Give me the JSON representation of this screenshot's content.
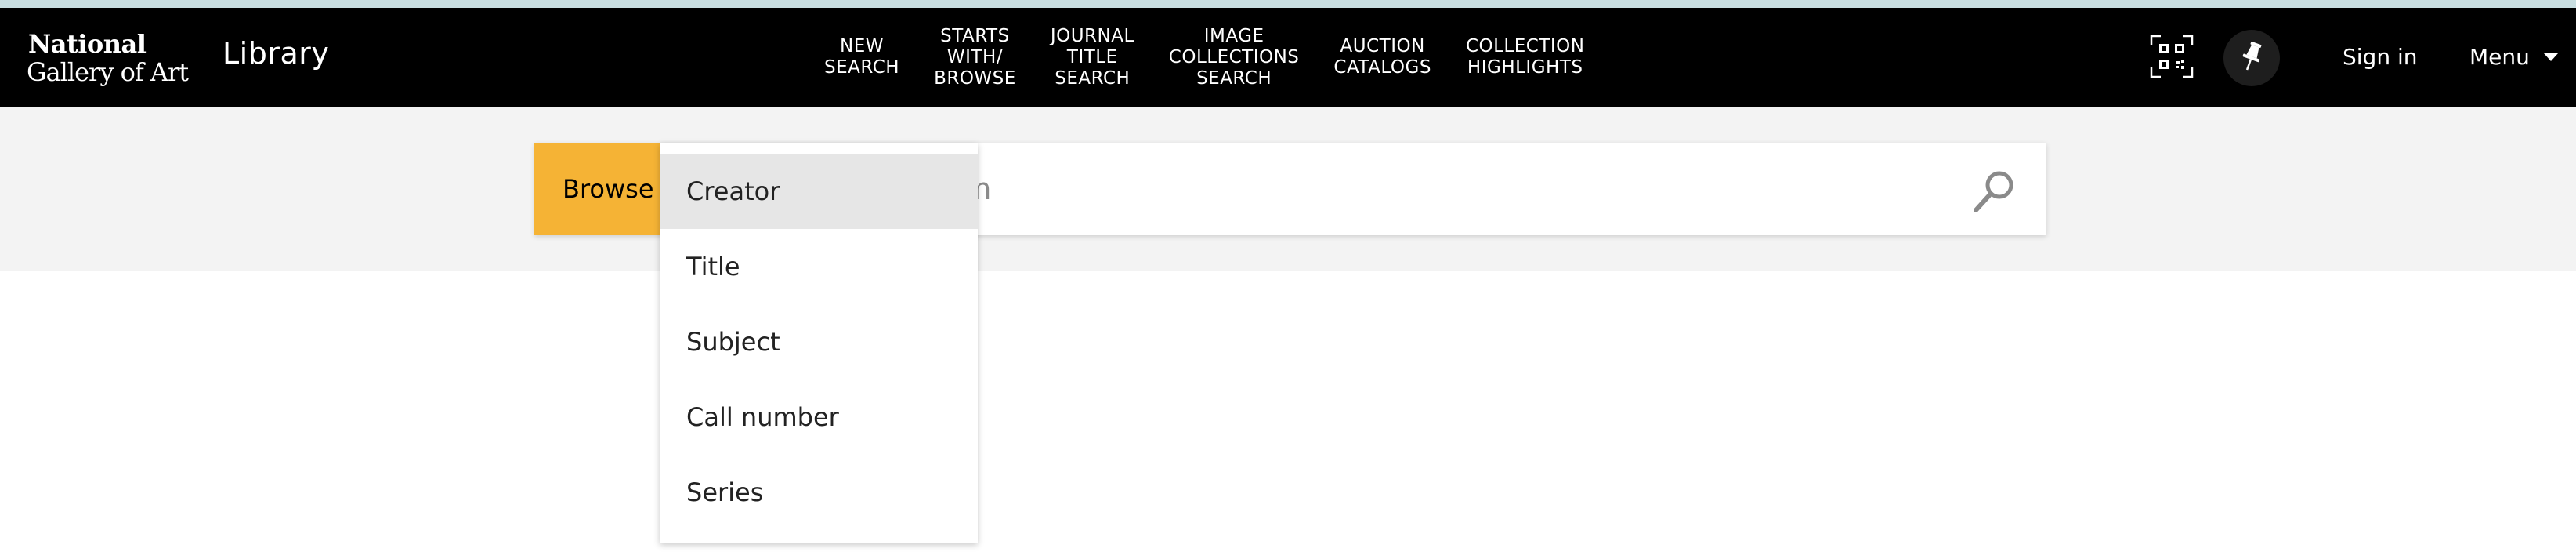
{
  "header": {
    "logo_line1": "National",
    "logo_line2": "Gallery of Art",
    "section_title": "Library",
    "nav": [
      {
        "label": "NEW\nSEARCH"
      },
      {
        "label": "STARTS\nWITH/\nBROWSE"
      },
      {
        "label": "JOURNAL\nTITLE\nSEARCH"
      },
      {
        "label": "IMAGE\nCOLLECTIONS\nSEARCH"
      },
      {
        "label": "AUCTION\nCATALOGS"
      },
      {
        "label": "COLLECTION\nHIGHLIGHTS"
      }
    ],
    "icons": {
      "qr": "qr-code-icon",
      "pin": "pushpin-icon"
    },
    "sign_in": "Sign in",
    "menu": "Menu"
  },
  "search": {
    "browse_label": "Browse by",
    "placeholder": "Search term",
    "visible_placeholder_fragment": "erm",
    "search_icon": "magnifier-icon"
  },
  "dropdown": {
    "options": [
      "Creator",
      "Title",
      "Subject",
      "Call number",
      "Series"
    ],
    "selected": "Creator"
  },
  "colors": {
    "nav_bg": "#000000",
    "accent": "#f5b335",
    "band_bg": "#f3f3f3",
    "top_strip": "#c8dde0",
    "selected_bg": "#e6e6e6"
  }
}
